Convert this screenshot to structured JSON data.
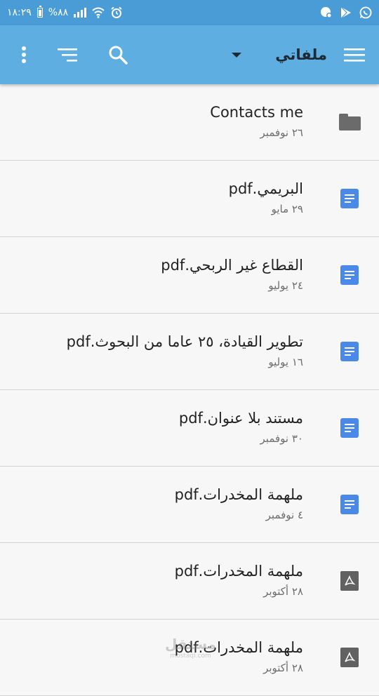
{
  "status_bar": {
    "time": "١٨:٢٩",
    "battery": "%٨٨",
    "battery_level": 0.88,
    "icons": [
      "signal-icon",
      "wifi-icon",
      "alarm-icon",
      "notification-icon",
      "play-store-icon",
      "whatsapp-icon"
    ]
  },
  "app_bar": {
    "title": "ملفاتي",
    "actions": [
      "menu-icon",
      "dropdown-icon",
      "search-icon",
      "sort-icon",
      "more-icon"
    ],
    "accent": "#5eaee2"
  },
  "files": [
    {
      "name": "Contacts me",
      "date": "٢٦ نوفمبر",
      "type": "folder"
    },
    {
      "name": "البريمي.pdf",
      "date": "٢٩ مايو",
      "type": "doc"
    },
    {
      "name": "القطاع غير الربحي.pdf",
      "date": "٢٤ يوليو",
      "type": "doc"
    },
    {
      "name": "تطوير القيادة، ٢٥ عاما من البحوث.pdf",
      "date": "١٦ يوليو",
      "type": "doc"
    },
    {
      "name": "مستند بلا عنوان.pdf",
      "date": "٣٠ نوفمبر",
      "type": "doc"
    },
    {
      "name": "ملهمة المخدرات.pdf",
      "date": "٤ نوفمبر",
      "type": "doc"
    },
    {
      "name": "ملهمة المخدرات.pdf",
      "date": "٢٨ أكتوبر",
      "type": "pdf"
    },
    {
      "name": "ملهمة المخدرات.pdf",
      "date": "٢٨ أكتوبر",
      "type": "pdf"
    }
  ],
  "watermark": {
    "text": "مستقل",
    "sub": "mostaql.com"
  }
}
